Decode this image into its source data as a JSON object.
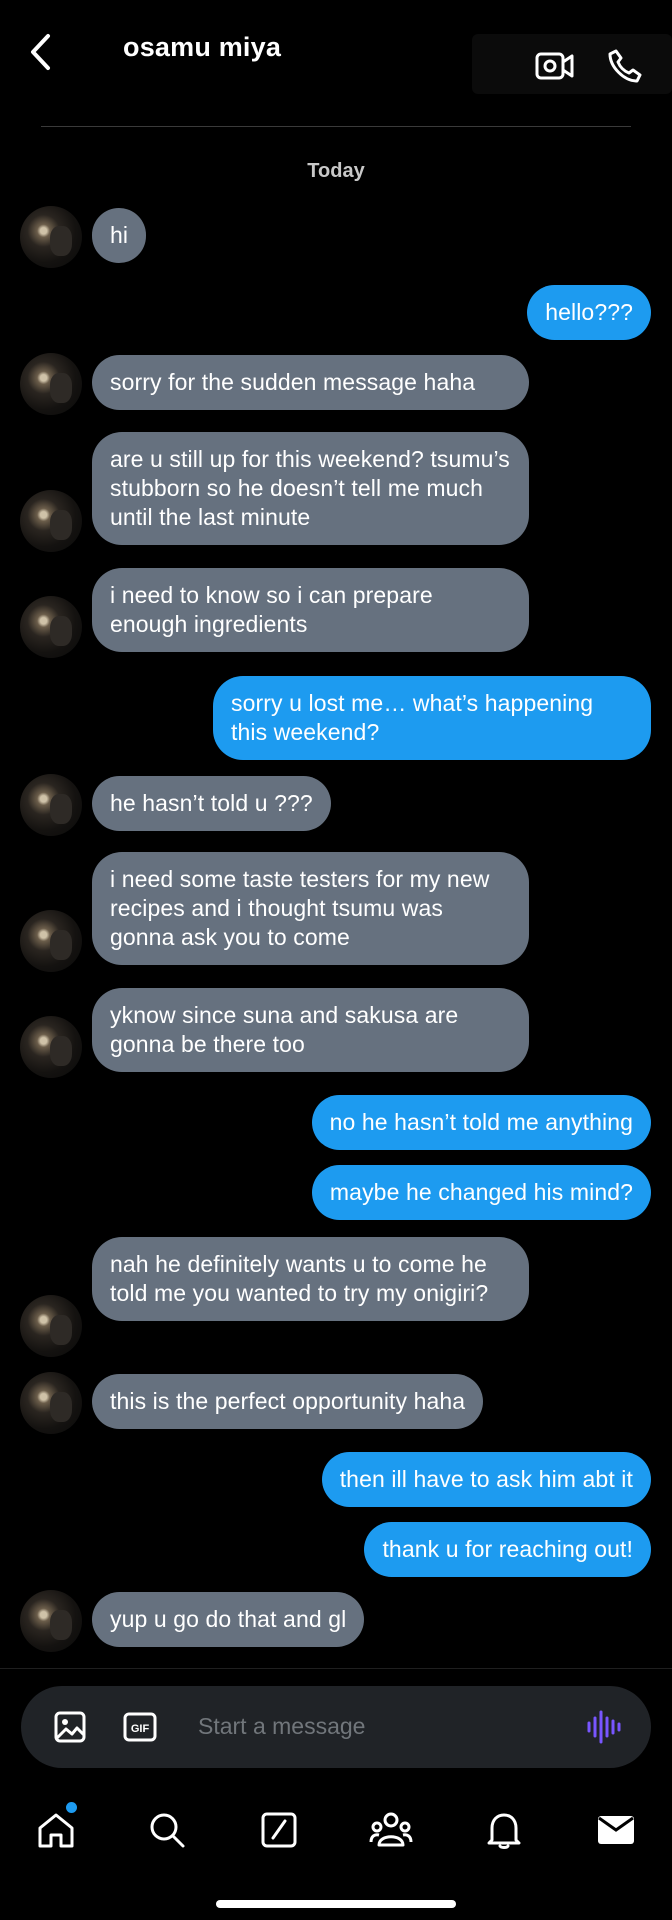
{
  "header": {
    "title": "osamu miya",
    "back_icon": "chevron-left-icon",
    "video_icon": "video-camera-icon",
    "phone_icon": "phone-icon"
  },
  "date_divider": "Today",
  "messages": [
    {
      "dir": "in",
      "text": "hi",
      "avatar": true
    },
    {
      "dir": "out",
      "text": "hello???"
    },
    {
      "dir": "in",
      "text": "sorry for the sudden message haha",
      "avatar": true
    },
    {
      "dir": "in",
      "text": "are u still up for this weekend? tsumu’s stubborn so he doesn’t tell me much until the last minute",
      "avatar": true
    },
    {
      "dir": "in",
      "text": "i need to know so i can prepare enough ingredients",
      "avatar": true
    },
    {
      "dir": "out",
      "text": "sorry u lost me… what’s happening this weekend?"
    },
    {
      "dir": "in",
      "text": "he hasn’t told u ???",
      "avatar": true
    },
    {
      "dir": "in",
      "text": "i need some taste testers for my new recipes and i thought tsumu was gonna ask you to come",
      "avatar": true
    },
    {
      "dir": "in",
      "text": "yknow since suna and sakusa are gonna be there too",
      "avatar": true
    },
    {
      "dir": "out",
      "text": "no he hasn’t told me anything"
    },
    {
      "dir": "out",
      "text": "maybe he changed his mind?"
    },
    {
      "dir": "in",
      "text": "nah he definitely wants u to come he told me you wanted to try my onigiri?",
      "avatar": true
    },
    {
      "dir": "in",
      "text": "this is the perfect opportunity haha",
      "avatar": true
    },
    {
      "dir": "out",
      "text": "then ill have to ask him abt it"
    },
    {
      "dir": "out",
      "text": "thank u for reaching out!"
    },
    {
      "dir": "in",
      "text": "yup u go do that and gl",
      "avatar": true
    }
  ],
  "composer": {
    "placeholder": "Start a message",
    "image_icon": "image-icon",
    "gif_icon": "gif-icon",
    "gif_label": "GIF",
    "voice_icon": "voice-wave-icon",
    "accent": "#7856ff"
  },
  "tabbar": {
    "items": [
      "home-icon",
      "search-icon",
      "compose-icon",
      "communities-icon",
      "bell-icon",
      "mail-icon"
    ],
    "active": "mail-icon",
    "notification_dot_color": "#1d9bf0"
  },
  "colors": {
    "incoming_bubble": "#66717f",
    "outgoing_bubble": "#1d9bf0",
    "background": "#000000"
  }
}
